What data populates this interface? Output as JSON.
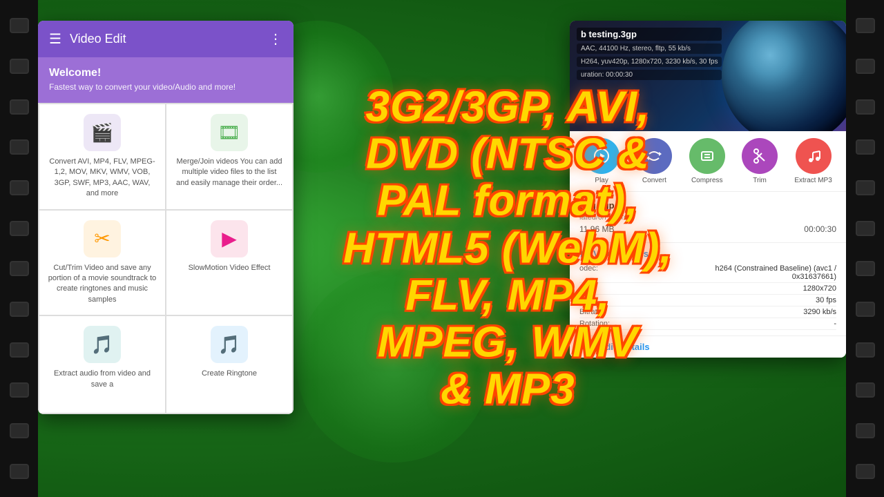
{
  "background": {
    "color": "#1a8a1a"
  },
  "film": {
    "holes_count": 14
  },
  "overlay": {
    "text": "3G2/3GP, AVI, DVD (NTSC & PAL format), HTML5 (WebM), FLV, MP4, MPEG, WMV & MP3"
  },
  "android_panel": {
    "header": {
      "title": "Video Edit",
      "hamburger_label": "☰",
      "more_label": "⋮"
    },
    "welcome": {
      "title": "Welcome!",
      "subtitle": "Fastest way to convert your video/Audio and more!"
    },
    "grid_items": [
      {
        "id": "convert",
        "icon": "🎬",
        "icon_bg": "purple",
        "text": "Convert AVI, MP4, FLV, MPEG-1,2, MOV, MKV, WMV, VOB, 3GP, SWF, MP3, AAC, WAV, and more"
      },
      {
        "id": "merge",
        "icon": "🎞",
        "icon_bg": "green",
        "text": "Merge/Join videos You can add multiple video files to the list and easily manage their order..."
      },
      {
        "id": "trim",
        "icon": "✂",
        "icon_bg": "orange",
        "text": "Cut/Trim Video and save any portion of a movie soundtrack to create ringtones and music samples"
      },
      {
        "id": "slowmotion",
        "icon": "▶",
        "icon_bg": "pink",
        "text": "SlowMotion Video Effect"
      },
      {
        "id": "extract",
        "icon": "🎵",
        "icon_bg": "teal",
        "text": "Extract audio from video and save a"
      },
      {
        "id": "ringtone",
        "icon": "🎵",
        "icon_bg": "blue",
        "text": "Create Ringtone"
      }
    ]
  },
  "video_panel": {
    "filename": "b testing.3gp",
    "meta_line1": "AAC, 44100 Hz, stereo, fltp, 55 kb/s",
    "meta_line2": "H264, yuv420p, 1280x720, 3230 kb/s, 30 fps",
    "meta_line3": "uration: 00:00:30",
    "action_buttons": [
      {
        "id": "play",
        "label": "Play",
        "icon": "↺",
        "color": "blue"
      },
      {
        "id": "convert",
        "label": "Convert",
        "icon": "⇄",
        "color": "indigo"
      },
      {
        "id": "compress",
        "label": "Compress",
        "icon": "✂",
        "color": "green"
      },
      {
        "id": "trim",
        "label": "Trim",
        "icon": "✂",
        "color": "purple"
      },
      {
        "id": "extract_mp3",
        "label": "Extract MP3",
        "icon": "♪",
        "color": "red"
      }
    ],
    "file_info": {
      "name": "ting.3gp",
      "path": "lated/0/Pictures",
      "size": "11,96 MB",
      "duration": "00:00:30"
    },
    "video_details": {
      "title": "Video details",
      "rows": [
        {
          "label": "odec:",
          "value": "h264 (Constrained Baseline) (avc1 / 0x31637661)"
        },
        {
          "label": "Size:",
          "value": "1280x720"
        },
        {
          "label": "Fps:",
          "value": "30 fps"
        },
        {
          "label": "Bitrate:",
          "value": "3290 kb/s"
        },
        {
          "label": "Rotation:",
          "value": "-"
        }
      ]
    },
    "audio_details": {
      "title": "Audio details"
    }
  }
}
